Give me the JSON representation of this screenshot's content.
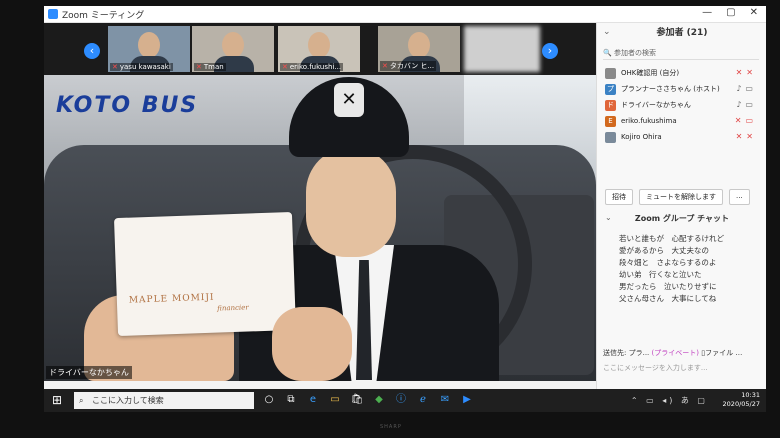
{
  "window": {
    "title": "Zoom ミーティング",
    "controls": [
      "—",
      "▢",
      "✕"
    ]
  },
  "gallery": [
    {
      "name": "yasu kawasaki",
      "muted": true
    },
    {
      "name": "Tman",
      "muted": true
    },
    {
      "name": "eriko.fukushi...",
      "muted": true
    },
    {
      "name": "タカバン ヒ...",
      "muted": true
    }
  ],
  "gallery_nav": {
    "left": "‹",
    "right": "›"
  },
  "main_video": {
    "speaker_label": "ドライバーなかちゃん",
    "logo_text": "KOTO BUS",
    "card_brand": "MAPLE MOMIJI",
    "card_sub": "financier"
  },
  "participants_panel": {
    "title": "参加者 (21)",
    "search_placeholder": "参加者の検索",
    "participants": [
      {
        "name": "OHK確認用 (自分)",
        "avatar_color": "#8a8a8a",
        "initial": ""
      },
      {
        "name": "プランナーささちゃん (ホスト)",
        "avatar_color": "#3b82c4",
        "initial": "プ"
      },
      {
        "name": "ドライバーなかちゃん",
        "avatar_color": "#e0663a",
        "initial": "ド"
      },
      {
        "name": "eriko.fukushima",
        "avatar_color": "#d2691e",
        "initial": "E"
      },
      {
        "name": "Kojiro Ohira",
        "avatar_color": "#7a8a9a",
        "initial": ""
      }
    ],
    "buttons": [
      "招待",
      "ミュートを解除します",
      "..."
    ]
  },
  "chat": {
    "title": "Zoom グループ チャット",
    "lines": [
      "若いと誰もが　心配するけれど",
      "愛があるから　大丈夫なの",
      "段々畑と　さよならするのよ",
      "幼い弟　行くなと泣いた",
      "男だったら　泣いたりせずに",
      "父さん母さん　大事にしてね"
    ],
    "to_label": "送信先:",
    "to_value": "プラ...",
    "private_label": "(プライベート)",
    "file_label": "ファイル",
    "input_placeholder": "ここにメッセージを入力します..."
  },
  "taskbar": {
    "search_text": "ここに入力して検索",
    "time": "10:31",
    "date": "2020/05/27",
    "ime": "あ"
  },
  "monitor_brand": "SHARP"
}
